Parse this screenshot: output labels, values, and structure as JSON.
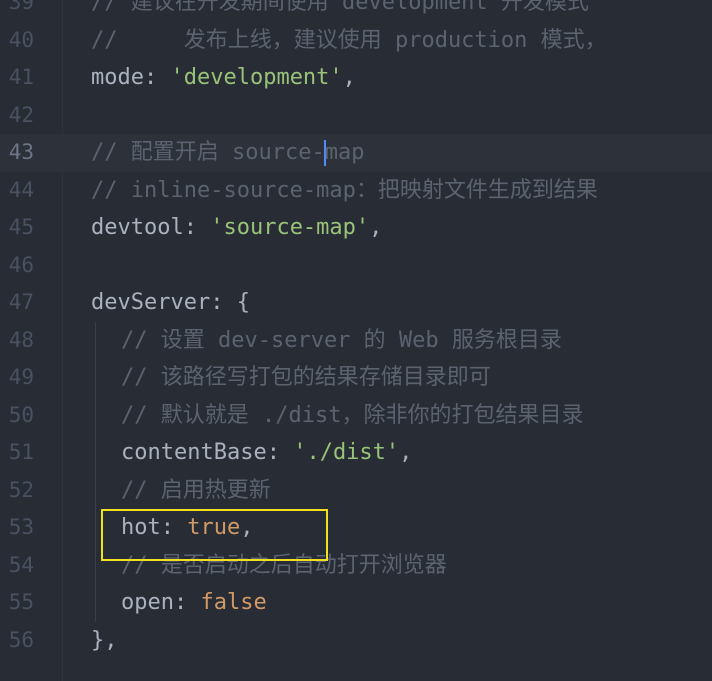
{
  "lines": [
    {
      "n": "39",
      "tokens": [
        {
          "t": "// 建议在开发期间使用 development 开发模式",
          "c": "cmt"
        }
      ]
    },
    {
      "n": "40",
      "tokens": [
        {
          "t": "//     发布上线，建议使用 production 模式，",
          "c": "cmt"
        }
      ]
    },
    {
      "n": "41",
      "tokens": [
        {
          "t": "mode",
          "c": "prop"
        },
        {
          "t": ": ",
          "c": "punc"
        },
        {
          "t": "'development'",
          "c": "str"
        },
        {
          "t": ",",
          "c": "punc"
        }
      ]
    },
    {
      "n": "42",
      "tokens": []
    },
    {
      "n": "43",
      "tokens": [
        {
          "t": "// 配置开启 source-",
          "c": "cmt"
        },
        {
          "t": "map",
          "c": "cmt"
        }
      ],
      "active": true,
      "cursor_after": 0
    },
    {
      "n": "44",
      "tokens": [
        {
          "t": "// inline-source-map：把映射文件生成到结果",
          "c": "cmt"
        }
      ]
    },
    {
      "n": "45",
      "tokens": [
        {
          "t": "devtool",
          "c": "prop"
        },
        {
          "t": ": ",
          "c": "punc"
        },
        {
          "t": "'source-map'",
          "c": "str"
        },
        {
          "t": ",",
          "c": "punc"
        }
      ]
    },
    {
      "n": "46",
      "tokens": []
    },
    {
      "n": "47",
      "tokens": [
        {
          "t": "devServer",
          "c": "prop"
        },
        {
          "t": ": {",
          "c": "punc"
        }
      ]
    },
    {
      "n": "48",
      "indent": true,
      "tokens": [
        {
          "t": "// 设置 dev-server 的 Web 服务根目录",
          "c": "cmt"
        }
      ]
    },
    {
      "n": "49",
      "indent": true,
      "tokens": [
        {
          "t": "// 该路径写打包的结果存储目录即可",
          "c": "cmt"
        }
      ]
    },
    {
      "n": "50",
      "indent": true,
      "tokens": [
        {
          "t": "// 默认就是 ./dist，除非你的打包结果目录",
          "c": "cmt"
        }
      ]
    },
    {
      "n": "51",
      "indent": true,
      "tokens": [
        {
          "t": "contentBase",
          "c": "prop"
        },
        {
          "t": ": ",
          "c": "punc"
        },
        {
          "t": "'./dist'",
          "c": "str"
        },
        {
          "t": ",",
          "c": "punc"
        }
      ]
    },
    {
      "n": "52",
      "indent": true,
      "tokens": [
        {
          "t": "// 启用热更新",
          "c": "cmt"
        }
      ]
    },
    {
      "n": "53",
      "indent": true,
      "tokens": [
        {
          "t": "hot",
          "c": "prop"
        },
        {
          "t": ": ",
          "c": "punc"
        },
        {
          "t": "true",
          "c": "bool"
        },
        {
          "t": ",",
          "c": "punc"
        }
      ]
    },
    {
      "n": "54",
      "indent": true,
      "tokens": [
        {
          "t": "// 是否启动之后自动打开浏览器",
          "c": "cmt"
        }
      ]
    },
    {
      "n": "55",
      "indent": true,
      "tokens": [
        {
          "t": "open",
          "c": "prop"
        },
        {
          "t": ": ",
          "c": "punc"
        },
        {
          "t": "false",
          "c": "bool"
        }
      ]
    },
    {
      "n": "56",
      "tokens": [
        {
          "t": "},",
          "c": "punc"
        }
      ]
    }
  ],
  "colors": {
    "background": "#282c34",
    "comment": "#5c6370",
    "string": "#98c379",
    "boolean": "#d19a66",
    "highlight": "#f0e020",
    "cursor": "#528bff"
  }
}
